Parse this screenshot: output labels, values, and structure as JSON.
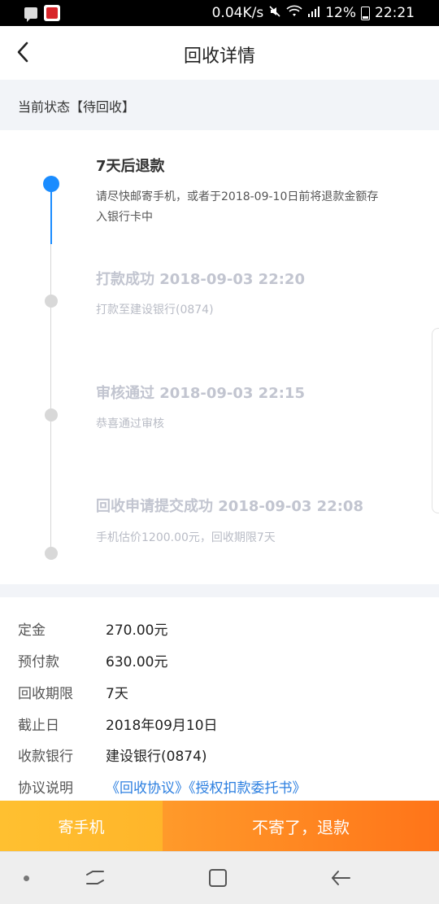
{
  "status_bar": {
    "network_speed": "0.04K/s",
    "battery": "12%",
    "time": "22:21",
    "icons": [
      "message-icon",
      "app-notification-icon",
      "mute-icon",
      "wifi-icon",
      "signal-icon",
      "battery-icon"
    ]
  },
  "header": {
    "title": "回收详情"
  },
  "status": {
    "text": "当前状态【待回收】"
  },
  "timeline": [
    {
      "title": "7天后退款",
      "desc": "请尽快邮寄手机，或者于2018-09-10日前将退款金额存入银行卡中",
      "active": true
    },
    {
      "title": "打款成功 2018-09-03 22:20",
      "desc": "打款至建设银行(0874)",
      "active": false
    },
    {
      "title": "审核通过 2018-09-03 22:15",
      "desc": "恭喜通过审核",
      "active": false
    },
    {
      "title": "回收申请提交成功 2018-09-03 22:08",
      "desc": "手机估价1200.00元，回收期限7天",
      "active": false
    }
  ],
  "info": [
    {
      "label": "定金",
      "value": "270.00元"
    },
    {
      "label": "预付款",
      "value": "630.00元"
    },
    {
      "label": "回收期限",
      "value": "7天"
    },
    {
      "label": "截止日",
      "value": "2018年09月10日"
    },
    {
      "label": "收款银行",
      "value": "建设银行(0874)"
    },
    {
      "label": "协议说明",
      "value": "《回收协议》《授权扣款委托书》"
    }
  ],
  "buttons": {
    "send_phone": "寄手机",
    "refund": "不寄了，退款"
  },
  "colors": {
    "accent_blue": "#1a8cff",
    "link_blue": "#2c7fe0",
    "button_yellow": "#ffb52a",
    "button_orange": "#ff7a1c"
  }
}
